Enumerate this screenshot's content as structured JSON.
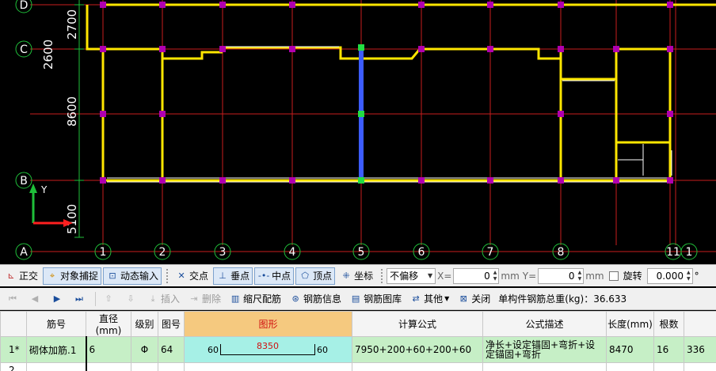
{
  "canvas": {
    "colors": {
      "background": "#000000",
      "axis": "#c81e1e",
      "wall": "#ffe600",
      "rebar": "#ffffff",
      "node": "#b000b0",
      "selected": "#3c5cff",
      "grid_label": "#1fbf3a"
    },
    "row_axes": [
      {
        "label": "D",
        "dim": "2700"
      },
      {
        "label": "C",
        "dim": "2600"
      },
      {
        "label": "B",
        "dim": "8600"
      },
      {
        "label": "A",
        "dim": "5100"
      }
    ],
    "col_axes": [
      "1",
      "2",
      "3",
      "4",
      "5",
      "6",
      "7",
      "8",
      "11",
      "1"
    ],
    "ucs": {
      "y_label": "Y"
    }
  },
  "snapbar": {
    "ortho": "正交",
    "object_snap": "对象捕捉",
    "dynamic_input": "动态输入",
    "intersection": "交点",
    "perpendicular": "垂点",
    "midpoint": "中点",
    "vertex": "顶点",
    "coordinate": "坐标",
    "offset_mode": "不偏移",
    "x_label": "X=",
    "x_value": "0",
    "y_label": "Y=",
    "y_value": "0",
    "unit_mm_1": "mm",
    "unit_mm_2": "mm",
    "rotate_label": "旋转",
    "rotate_value": "0.000",
    "degree": "°"
  },
  "rebarbar": {
    "insert": "插入",
    "delete": "删除",
    "scale_rebar": "缩尺配筋",
    "rebar_info": "钢筋信息",
    "rebar_library": "钢筋图库",
    "other": "其他",
    "close": "关闭",
    "total_weight": "单构件钢筋总重(kg)：36.633"
  },
  "table": {
    "headers": [
      "筋号",
      "直径(mm)",
      "级别",
      "图号",
      "图形",
      "计算公式",
      "公式描述",
      "长度(mm)",
      "根数",
      ""
    ],
    "rows": [
      {
        "num": "1*",
        "name": "砌体加筋.1",
        "diameter": "6",
        "grade": "Φ",
        "figure_no": "64",
        "shape_left": "60",
        "shape_mid": "8350",
        "shape_right": "60",
        "formula": "7950+200+60+200+60",
        "description": "净长+设定锚固+弯折+设定锚固+弯折",
        "length": "8470",
        "count": "16",
        "extra": "336"
      },
      {
        "num": "2",
        "name": "",
        "diameter": "",
        "grade": "",
        "figure_no": "",
        "shape_left": "",
        "shape_mid": "",
        "shape_right": "",
        "formula": "",
        "description": "",
        "length": "",
        "count": "",
        "extra": ""
      }
    ]
  }
}
